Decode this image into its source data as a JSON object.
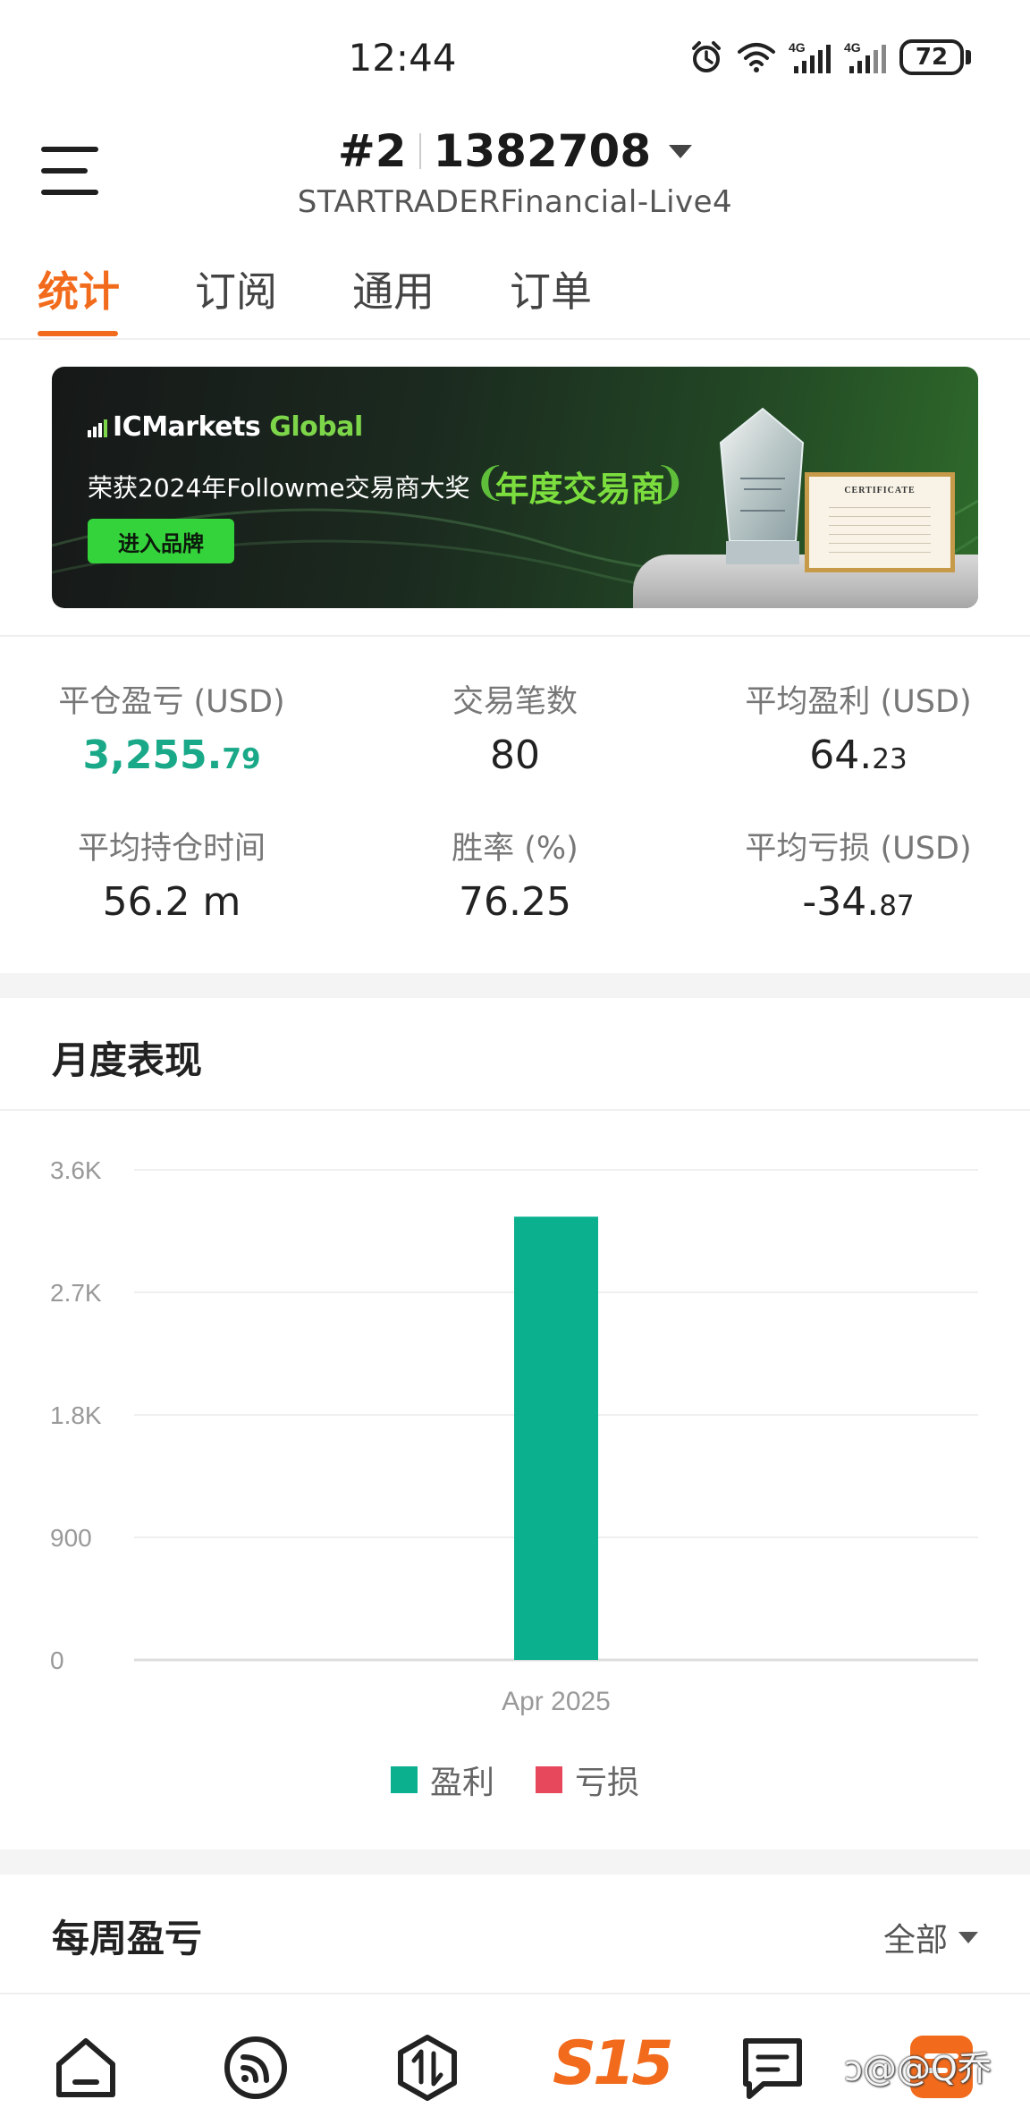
{
  "status_bar": {
    "time": "12:44",
    "battery": "72",
    "network_1": "4G",
    "network_2": "4G"
  },
  "header": {
    "account_rank": "#2",
    "account_id": "1382708",
    "server": "STARTRADERFinancial-Live4"
  },
  "tabs": [
    {
      "label": "统计",
      "active": true
    },
    {
      "label": "订阅",
      "active": false
    },
    {
      "label": "通用",
      "active": false
    },
    {
      "label": "订单",
      "active": false
    }
  ],
  "banner": {
    "logo_ic": "IC",
    "logo_markets": "Markets",
    "logo_global": "Global",
    "headline": "荣获2024年Followme交易商大奖",
    "award": "年度交易商",
    "cta": "进入品牌",
    "cert_title": "CERTIFICATE"
  },
  "stats": {
    "closed_pnl": {
      "label": "平仓盈亏 (USD)",
      "value_main": "3,255.",
      "value_small": "79"
    },
    "trade_count": {
      "label": "交易笔数",
      "value": "80"
    },
    "avg_profit": {
      "label": "平均盈利 (USD)",
      "value_main": "64.",
      "value_small": "23"
    },
    "avg_hold_time": {
      "label": "平均持仓时间",
      "value": "56.2 m"
    },
    "win_rate": {
      "label": "胜率 (%)",
      "value": "76.25"
    },
    "avg_loss": {
      "label": "平均亏损 (USD)",
      "value_main": "-34.",
      "value_small": "87"
    }
  },
  "monthly": {
    "title": "月度表现"
  },
  "chart_data": {
    "type": "bar",
    "categories": [
      "Apr 2025"
    ],
    "series": [
      {
        "name": "盈利",
        "values": [
          3255.79
        ],
        "color": "#0bb08f"
      },
      {
        "name": "亏损",
        "values": [
          0
        ],
        "color": "#e8485b"
      }
    ],
    "y_ticks": [
      "0",
      "900",
      "1.8K",
      "2.7K",
      "3.6K"
    ],
    "ylim": [
      0,
      3600
    ],
    "grid": true,
    "legend_position": "bottom-center"
  },
  "weekly": {
    "title": "每周盈亏",
    "filter": "全部"
  },
  "bottom_nav": {
    "s15_label": "S15",
    "items": [
      "home-icon",
      "feed-icon",
      "trade-icon",
      "s15-logo",
      "chat-icon",
      "profile-icon"
    ]
  },
  "watermark": "ↄ@@Q乔"
}
